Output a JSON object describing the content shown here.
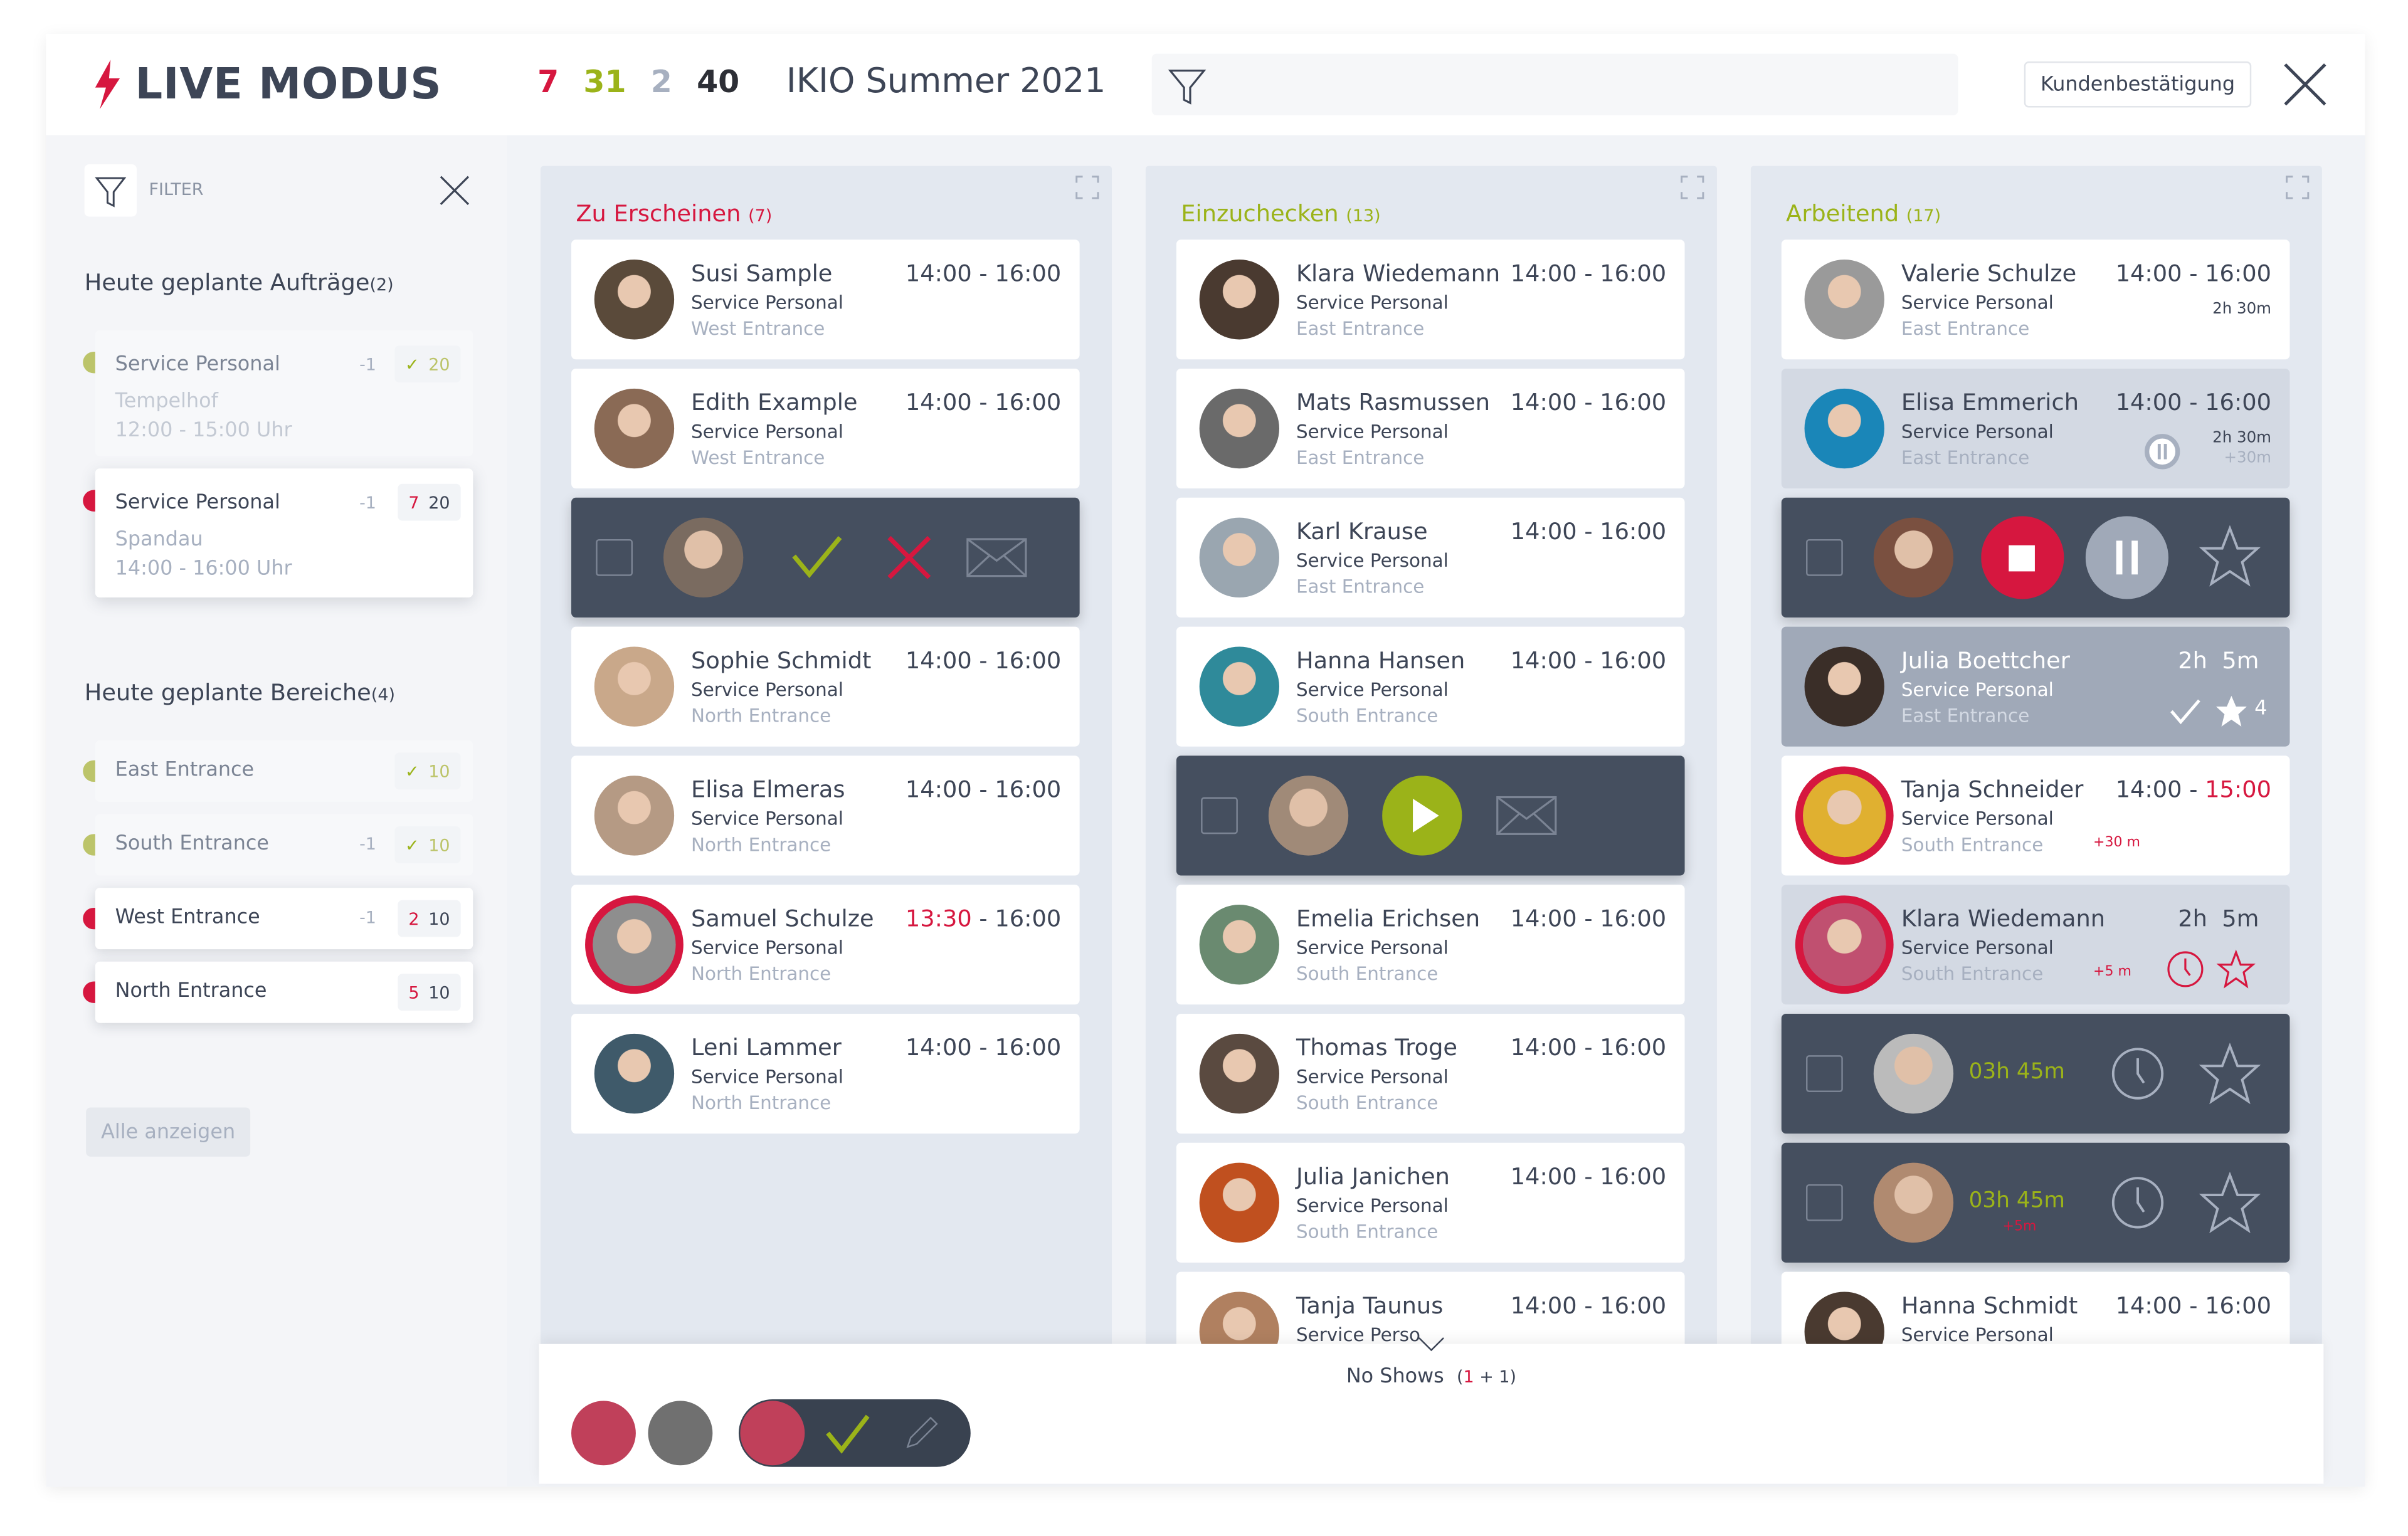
{
  "header": {
    "title": "LIVE MODUS",
    "counts": [
      {
        "value": "7",
        "color": "#d6173f"
      },
      {
        "value": "31",
        "color": "#9bb319"
      },
      {
        "value": "2",
        "color": "#a7b0c0"
      },
      {
        "value": "40",
        "color": "#2d2f36"
      }
    ],
    "event": "IKIO Summer 2021",
    "search_icon": "filter-icon",
    "confirm_label": "Kundenbestätigung",
    "close_icon": "close-icon"
  },
  "sidebar": {
    "filter_label": "FILTER",
    "orders_title": "Heute geplante Aufträge",
    "orders_count": "(2)",
    "orders": [
      {
        "title": "Service Personal",
        "minus": "-1",
        "badge_a": "✓",
        "badge_b": "20",
        "place": "Tempelhof",
        "time": "12:00 - 15:00 Uhr",
        "status": "#bcc46a",
        "faded": true
      },
      {
        "title": "Service Personal",
        "minus": "-1",
        "badge_a": "7",
        "badge_b": "20",
        "place": "Spandau",
        "time": "14:00 - 16:00 Uhr",
        "status": "#d6173f",
        "faded": false
      }
    ],
    "areas_title": "Heute geplante Bereiche",
    "areas_count": "(4)",
    "areas": [
      {
        "name": "East Entrance",
        "minus": "",
        "badge_a": "✓",
        "badge_b": "10",
        "status": "#bcc46a",
        "faded": true
      },
      {
        "name": "South Entrance",
        "minus": "-1",
        "badge_a": "✓",
        "badge_b": "10",
        "status": "#bcc46a",
        "faded": true
      },
      {
        "name": "West Entrance",
        "minus": "-1",
        "badge_a": "2",
        "badge_b": "10",
        "status": "#d6173f",
        "faded": false
      },
      {
        "name": "North Entrance",
        "minus": "",
        "badge_a": "5",
        "badge_b": "10",
        "status": "#d6173f",
        "faded": false
      }
    ],
    "show_all": "Alle anzeigen"
  },
  "columns": [
    {
      "title": "Zu Erscheinen",
      "count": "(7)",
      "color": "#d6173f",
      "cards": [
        {
          "type": "normal",
          "name": "Susi Sample",
          "role": "Service Personal",
          "location": "West Entrance",
          "start": "14:00",
          "end": "16:00",
          "avatar": "#5a4a3a"
        },
        {
          "type": "normal",
          "name": "Edith Example",
          "role": "Service Personal",
          "location": "West Entrance",
          "start": "14:00",
          "end": "16:00",
          "avatar": "#8a6a55"
        },
        {
          "type": "dark",
          "actions": [
            "checkbox",
            "avatar",
            "check-icon",
            "x-icon",
            "envelope-icon"
          ],
          "avatar": "#7a6b60"
        },
        {
          "type": "normal",
          "name": "Sophie Schmidt",
          "role": "Service Personal",
          "location": "North Entrance",
          "start": "14:00",
          "end": "16:00",
          "avatar": "#c9a88a"
        },
        {
          "type": "normal",
          "name": "Elisa Elmeras",
          "role": "Service Personal",
          "location": "North Entrance",
          "start": "14:00",
          "end": "16:00",
          "avatar": "#b59a84"
        },
        {
          "type": "normal",
          "ring": true,
          "name": "Samuel Schulze",
          "role": "Service Personal",
          "location": "North Entrance",
          "start": "13:30",
          "start_late": true,
          "end": "16:00",
          "avatar": "#8e8e8e"
        },
        {
          "type": "normal",
          "name": "Leni Lammer",
          "role": "Service Personal",
          "location": "North Entrance",
          "start": "14:00",
          "end": "16:00",
          "avatar": "#3f5a6a"
        }
      ]
    },
    {
      "title": "Einzuchecken",
      "count": "(13)",
      "color": "#9bb319",
      "cards": [
        {
          "type": "normal",
          "name": "Klara Wiedemann",
          "role": "Service Personal",
          "location": "East Entrance",
          "start": "14:00",
          "end": "16:00",
          "avatar": "#4a3a30"
        },
        {
          "type": "normal",
          "name": "Mats Rasmussen",
          "role": "Service Personal",
          "location": "East Entrance",
          "start": "14:00",
          "end": "16:00",
          "avatar": "#6a6a6a"
        },
        {
          "type": "normal",
          "name": "Karl Krause",
          "role": "Service Personal",
          "location": "East Entrance",
          "start": "14:00",
          "end": "16:00",
          "avatar": "#9aa6b0"
        },
        {
          "type": "normal",
          "name": "Hanna Hansen",
          "role": "Service Personal",
          "location": "South Entrance",
          "start": "14:00",
          "end": "16:00",
          "avatar": "#2f8a9a"
        },
        {
          "type": "dark",
          "actions": [
            "checkbox",
            "avatar",
            "play-icon",
            "envelope-icon"
          ],
          "avatar": "#a08a78"
        },
        {
          "type": "normal",
          "name": "Emelia Erichsen",
          "role": "Service Personal",
          "location": "South Entrance",
          "start": "14:00",
          "end": "16:00",
          "avatar": "#6a8a70"
        },
        {
          "type": "normal",
          "name": "Thomas Troge",
          "role": "Service Personal",
          "location": "South Entrance",
          "start": "14:00",
          "end": "16:00",
          "avatar": "#5a4a40"
        },
        {
          "type": "normal",
          "name": "Julia Janichen",
          "role": "Service Personal",
          "location": "South Entrance",
          "start": "14:00",
          "end": "16:00",
          "avatar": "#c0501f"
        },
        {
          "type": "normal",
          "name": "Tanja Taunus",
          "role": "Service Perso",
          "location": "",
          "start": "14:00",
          "end": "16:00",
          "avatar": "#b08060"
        }
      ]
    },
    {
      "title": "Arbeitend",
      "count": "(17)",
      "color": "#9bb319",
      "cards": [
        {
          "type": "normal",
          "name": "Valerie Schulze",
          "role": "Service Personal",
          "location": "East Entrance",
          "start": "14:00",
          "end": "16:00",
          "duration": "2h 30m",
          "avatar": "#9a9a9a"
        },
        {
          "type": "grey",
          "name": "Elisa Emmerich",
          "role": "Service Personal",
          "location": "East Entrance",
          "start": "14:00",
          "end": "16:00",
          "duration": "2h 30m",
          "extra": "+30m",
          "paused": true,
          "avatar": "#1a86b8"
        },
        {
          "type": "dark",
          "actions": [
            "checkbox",
            "avatar",
            "stop-icon",
            "pause-icon",
            "star-icon"
          ],
          "avatar": "#7a5040"
        },
        {
          "type": "dgrey",
          "name": "Julia Boettcher",
          "role": "Service Personal",
          "location": "East Entrance",
          "elapsed": "2h  5m",
          "rating": "4",
          "avatar": "#3a2e28"
        },
        {
          "type": "normal",
          "ring": true,
          "name": "Tanja Schneider",
          "role": "Service Personal",
          "location": "South Entrance",
          "start": "14:00",
          "end": "15:00",
          "end_late": true,
          "late": "+30 m",
          "avatar": "#e0b030"
        },
        {
          "type": "grey",
          "ring": true,
          "name": "Klara Wiedemann",
          "role": "Service Personal",
          "location": "South Entrance",
          "elapsed": "2h  5m",
          "late": "+5 m",
          "alert_icons": true,
          "avatar": "#c05070"
        },
        {
          "type": "dark",
          "actions": [
            "checkbox",
            "avatar",
            "timer",
            "clock-icon",
            "star-icon"
          ],
          "timer": "03h 45m",
          "avatar": "#bbbbbb"
        },
        {
          "type": "dark",
          "actions": [
            "checkbox",
            "avatar",
            "timer",
            "clock-icon",
            "star-icon"
          ],
          "timer": "03h 45m",
          "timer_extra": "+5m",
          "avatar": "#b08a70"
        },
        {
          "type": "normal",
          "name": "Hanna Schmidt",
          "role": "Service Personal",
          "location": "",
          "start": "14:00",
          "end": "16:00",
          "avatar": "#4a3a30"
        }
      ]
    }
  ],
  "no_shows": {
    "label": "No Shows",
    "count_open": "(",
    "count_a": "1",
    "count_sep": " + ",
    "count_b": "1",
    "count_close": ")",
    "avatars": [
      "#c0405a",
      "#707070",
      "#c0405a"
    ]
  }
}
